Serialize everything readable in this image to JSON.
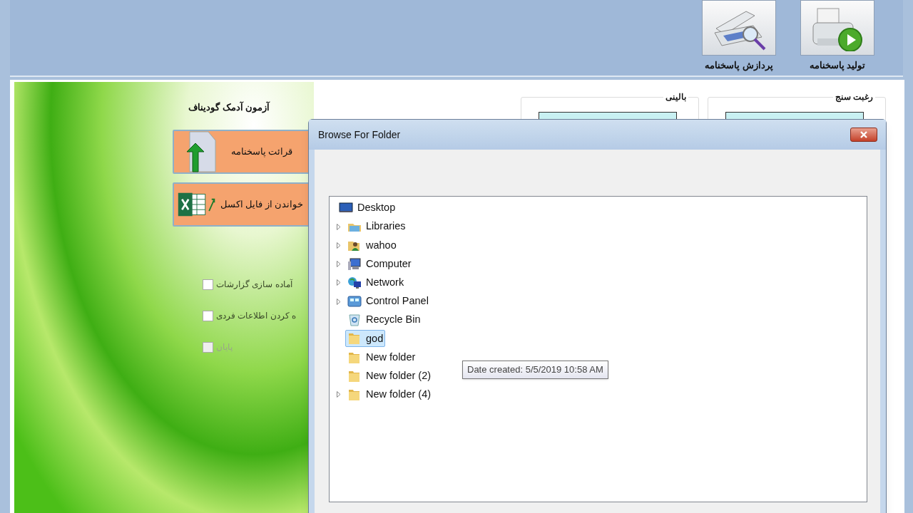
{
  "toolbar": {
    "buttons": [
      {
        "label": "تولید پاسخنامه",
        "kind": "printer"
      },
      {
        "label": "پردازش پاسخنامه",
        "kind": "scanner"
      }
    ]
  },
  "panel": {
    "title": "آزمون آدمک گودیناف",
    "actions": [
      {
        "label": "قرائت پاسخنامه",
        "kind": "upload"
      },
      {
        "label": "خواندن از فایل اکسل",
        "kind": "excel"
      }
    ],
    "options": [
      {
        "label": "آماده سازی گزارشات",
        "checked": false,
        "disabled": false
      },
      {
        "label": "ه کردن اطلاعات فردی",
        "checked": false,
        "disabled": false
      },
      {
        "label": "پایان",
        "checked": false,
        "disabled": true
      }
    ]
  },
  "groups": [
    {
      "title": "رغبت سنج"
    },
    {
      "title": "بالینی"
    }
  ],
  "dialog": {
    "title": "Browse For Folder",
    "tree": [
      {
        "label": "Desktop",
        "kind": "desktop",
        "expandable": false,
        "selected": false
      },
      {
        "label": "Libraries",
        "kind": "libraries",
        "expandable": true,
        "selected": false
      },
      {
        "label": "wahoo",
        "kind": "user",
        "expandable": true,
        "selected": false
      },
      {
        "label": "Computer",
        "kind": "computer",
        "expandable": true,
        "selected": false
      },
      {
        "label": "Network",
        "kind": "network",
        "expandable": true,
        "selected": false
      },
      {
        "label": "Control Panel",
        "kind": "control-panel",
        "expandable": true,
        "selected": false
      },
      {
        "label": "Recycle Bin",
        "kind": "recycle-bin",
        "expandable": false,
        "selected": false
      },
      {
        "label": "god",
        "kind": "folder",
        "expandable": false,
        "selected": true
      },
      {
        "label": "New folder",
        "kind": "folder",
        "expandable": false,
        "selected": false
      },
      {
        "label": "New folder (2)",
        "kind": "folder",
        "expandable": false,
        "selected": false
      },
      {
        "label": "New folder (4)",
        "kind": "folder",
        "expandable": true,
        "selected": false
      }
    ],
    "tooltip": "Date created: 5/5/2019 10:58 AM"
  }
}
